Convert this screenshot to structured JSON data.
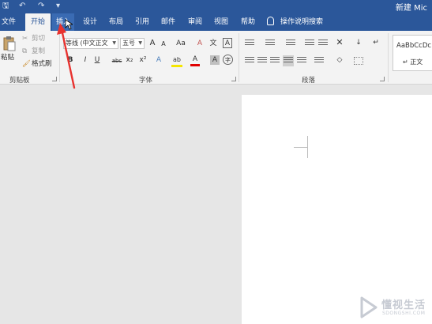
{
  "title_bar": {
    "quick_access": [
      "🖫",
      "↶",
      "↷",
      "▾"
    ],
    "document_title": "新建 Mic"
  },
  "tabs": [
    {
      "label": "文件"
    },
    {
      "label": "开始"
    },
    {
      "label": "插入"
    },
    {
      "label": "设计"
    },
    {
      "label": "布局"
    },
    {
      "label": "引用"
    },
    {
      "label": "邮件"
    },
    {
      "label": "审阅"
    },
    {
      "label": "视图"
    },
    {
      "label": "帮助"
    }
  ],
  "tell_me": "操作说明搜索",
  "clipboard": {
    "paste": "粘贴",
    "cut": "剪切",
    "copy": "复制",
    "format_painter": "格式刷",
    "group_label": "剪贴板"
  },
  "font": {
    "font_name": "等线 (中文正文",
    "font_size": "五号",
    "grow": "A",
    "shrink": "A",
    "change_case": "Aa",
    "clear_format": "A",
    "phonetic": "文",
    "border_char": "A",
    "bold": "B",
    "italic": "I",
    "underline": "U",
    "strikethrough": "abc",
    "subscript": "x₂",
    "superscript": "x²",
    "text_effects": "A",
    "highlight": "ab",
    "font_color": "A",
    "char_shading": "A",
    "enclose": "字",
    "group_label": "字体"
  },
  "paragraph": {
    "group_label": "段落"
  },
  "styles": {
    "sample": "AaBbCcDc",
    "name": "↵ 正文"
  },
  "watermark": {
    "brand": "懂视生活",
    "sub": "SDONGSHI.COM"
  },
  "colors": {
    "title_bar": "#2b579a",
    "ribbon": "#f3f3f3",
    "workspace": "#e6e6e6",
    "annotation_arrow": "#e8322f"
  }
}
